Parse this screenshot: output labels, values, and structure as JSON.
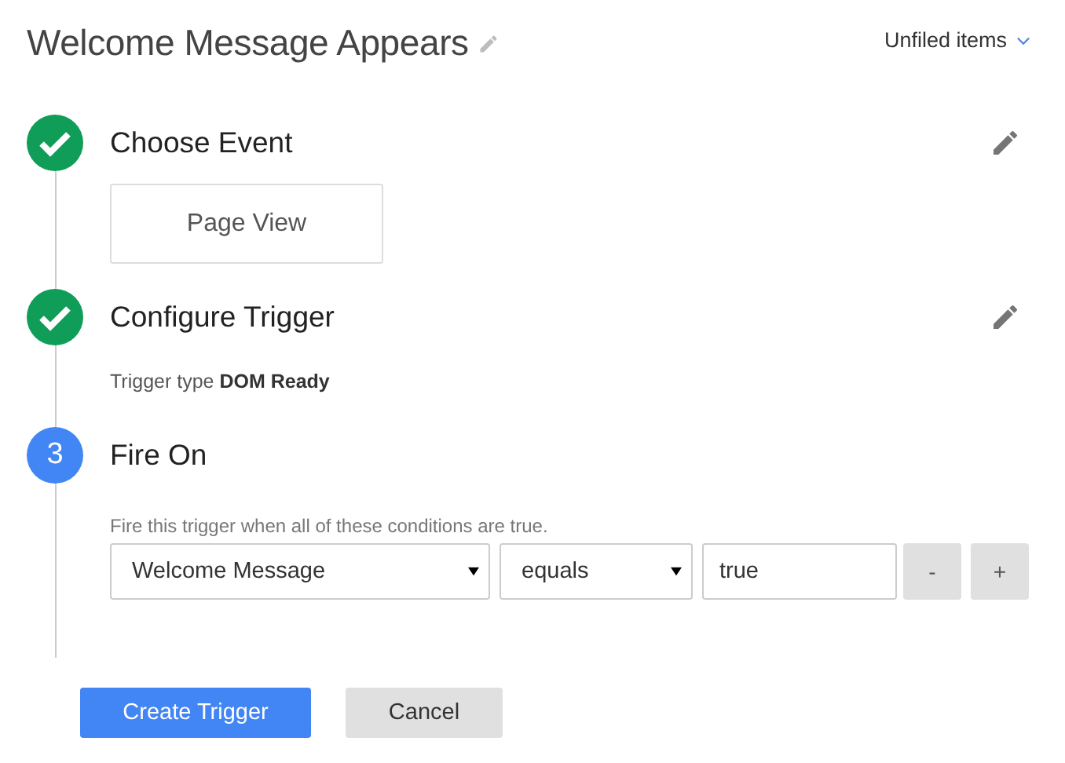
{
  "header": {
    "title": "Welcome Message Appears",
    "folder": "Unfiled items"
  },
  "steps": [
    {
      "kind": "done",
      "title": "Choose Event",
      "editable": true,
      "body": {
        "kind": "event",
        "label": "Page View"
      }
    },
    {
      "kind": "done",
      "title": "Configure Trigger",
      "editable": true,
      "body": {
        "kind": "info",
        "text": "Trigger type **DOM Ready**"
      }
    },
    {
      "kind": "current",
      "number": "3",
      "title": "Fire On",
      "editable": false,
      "body": {
        "kind": "conditions",
        "hint": "Fire this trigger when all of these conditions are true.",
        "variable": "Welcome Message",
        "operator": "equals",
        "value": "true",
        "remove": "-",
        "add": "+"
      }
    }
  ],
  "buttons": [
    {
      "label": "Create Trigger",
      "primary": true
    },
    {
      "label": "Cancel",
      "primary": false
    }
  ]
}
